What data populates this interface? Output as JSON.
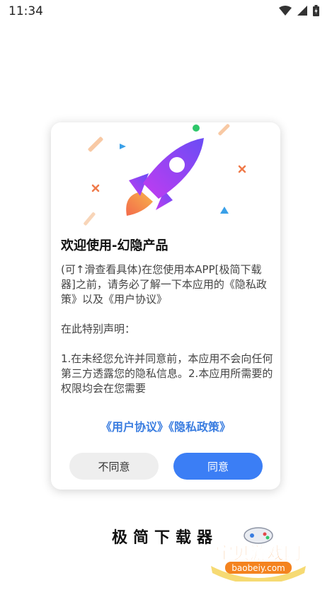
{
  "status_bar": {
    "time": "11:34"
  },
  "dialog": {
    "title": "欢迎使用-幻隐产品",
    "body_paragraphs": [
      "(可↑滑查看具体)在您使用本APP[极简下载器]之前，请务必了解一下本应用的《隐私政策》以及《用户协议》",
      "在此特别声明：",
      "1.在未经您允许并同意前，本应用不会向任何第三方透露您的隐私信息。2.本应用所需要的权限均会在您需要"
    ],
    "link_user_agreement": "《用户协议》",
    "link_privacy_policy": "《隐私政策》",
    "decline_label": "不同意",
    "agree_label": "同意"
  },
  "footer": {
    "app_name": "极简下载器",
    "watermark_text": "宝贝游戏网",
    "watermark_url": "baobeiy.com"
  },
  "colors": {
    "accent": "#3b7ef5",
    "link": "#3a7de0",
    "decline_bg": "#eeeeee"
  }
}
